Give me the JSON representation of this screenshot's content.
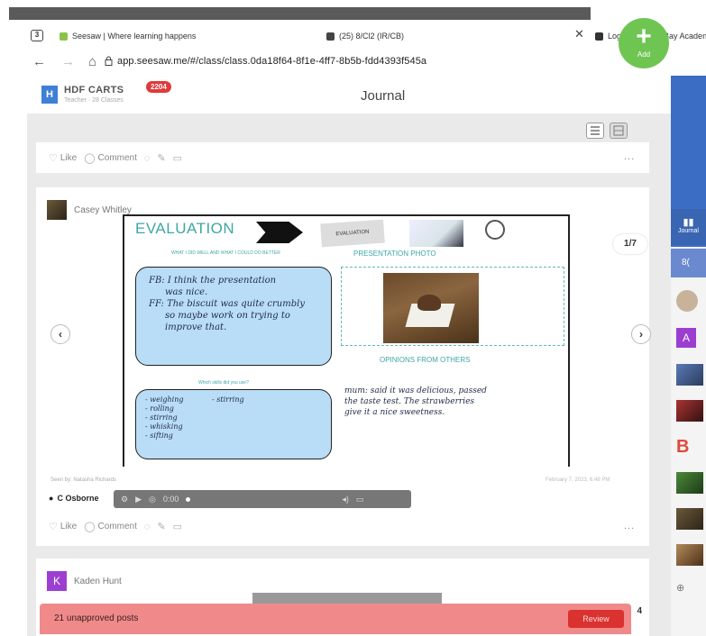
{
  "browser": {
    "tab_count": "3",
    "tabs": [
      {
        "title": "Seesaw | Where learning happens"
      },
      {
        "title": "(25) 8/Cl2 (IR/CB)"
      },
      {
        "title": "Login - Mounts Bay Acaden"
      }
    ],
    "url": "app.seesaw.me/#/class/class.0da18f64-8f1e-4ff7-8b5b-fdd4393f545a"
  },
  "header": {
    "class_initial": "H",
    "class_name": "HDF CARTS",
    "class_sub": "Teacher · 28 Classes",
    "notification_count": "2204",
    "title": "Journal",
    "add_label": "Add"
  },
  "actions": {
    "like": "Like",
    "comment": "Comment",
    "more": "..."
  },
  "post1": {
    "author": "Casey Whitley",
    "slide_counter": "1/7",
    "seen_by": "Seen by: Natasha Richards",
    "date": "February 7, 2023, 6:48 PM",
    "commenter": "C Osborne",
    "audio_time": "0:00"
  },
  "slide": {
    "title": "EVALUATION",
    "stamp": "EVALUATION",
    "subtitle": "WHAT I DID WELL AND WHAT I COULD DO BETTER",
    "photo_label": "PRESENTATION PHOTO",
    "opinions_label": "OPINIONS FROM OTHERS",
    "skills_label": "Which skills did you use?",
    "feedback_lines": [
      "FB: I think the presentation",
      "was nice.",
      "FF: The biscuit was quite crumbly",
      "so maybe work on trying to",
      "improve that."
    ],
    "skills_left": [
      "- weighing",
      "- rolling",
      "- stirring",
      "- whisking",
      "- sifting"
    ],
    "skills_right": "- stirring",
    "opinion_lines": [
      "mum: said it was delicious, passed",
      "the taste test. The strawberries",
      "give it a nice sweetness."
    ]
  },
  "post2": {
    "author_initial": "K",
    "author": "Kaden Hunt"
  },
  "review": {
    "text": "21 unapproved posts",
    "button": "Review",
    "corner_count": "4"
  },
  "sidebar": {
    "journal_label": "Journal",
    "class_label": "8(",
    "avatar_a": "A",
    "avatar_b": "B"
  },
  "colors": {
    "seesaw_green": "#6fc552",
    "header_blue": "#3f7fd6",
    "badge_red": "#e03a3a",
    "review_bar": "#f08a8a",
    "review_button": "#d9322f"
  }
}
